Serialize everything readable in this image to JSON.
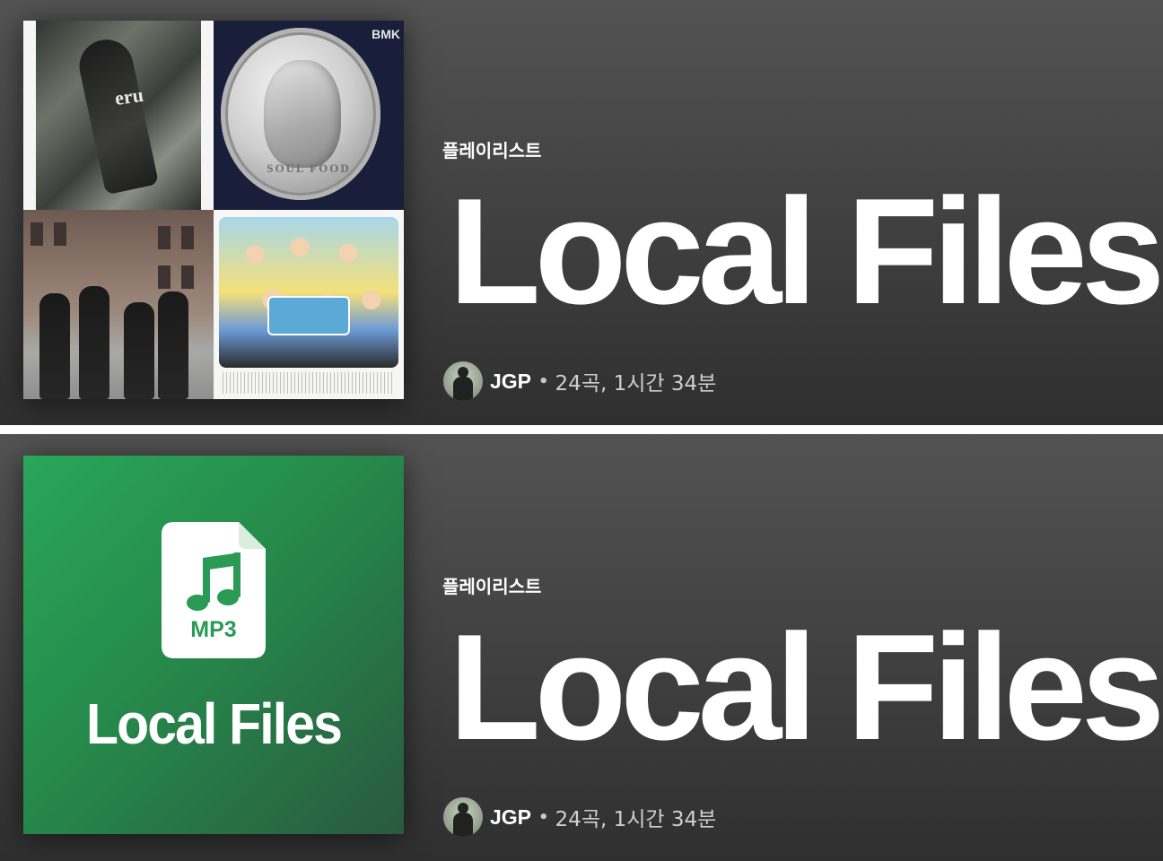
{
  "panels": [
    {
      "cover_type": "mosaic",
      "cover": {
        "tile1_text": "eru",
        "tile2_logo": "BMK",
        "tile2_coin_text": "SOUL FOOD"
      },
      "type_label": "플레이리스트",
      "title": "Local Files",
      "owner": "JGP",
      "separator": "•",
      "stats": "24곡, 1시간 34분"
    },
    {
      "cover_type": "local-files",
      "cover": {
        "badge": "MP3",
        "title": "Local Files"
      },
      "type_label": "플레이리스트",
      "title": "Local Files",
      "owner": "JGP",
      "separator": "•",
      "stats": "24곡, 1시간 34분"
    }
  ],
  "colors": {
    "background": "#3f3f3f",
    "cover_green": "#2aa65a",
    "text": "#ffffff",
    "subtext": "#cfcfcf"
  },
  "icons": [
    "music-file-icon",
    "music-note-icon",
    "avatar"
  ]
}
